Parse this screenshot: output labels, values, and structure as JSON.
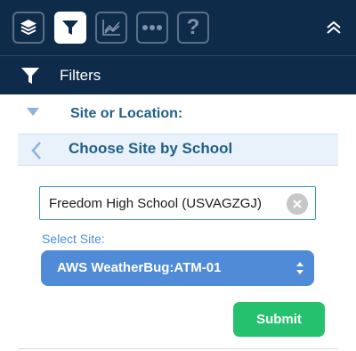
{
  "toolbar": {
    "buttons": [
      {
        "name": "layers-icon",
        "active": false
      },
      {
        "name": "filter-icon",
        "active": true
      },
      {
        "name": "chart-icon",
        "active": false
      },
      {
        "name": "more-icon",
        "active": false
      },
      {
        "name": "help-icon",
        "active": false,
        "glyph": "?"
      }
    ],
    "collapse_icon": "chevron-up-double-icon"
  },
  "filters": {
    "title": "Filters"
  },
  "site_section": {
    "label": "Site or Location:"
  },
  "choose": {
    "title": "Choose Site by School"
  },
  "school_search": {
    "value": "Freedom High School (USVAGZGJ)"
  },
  "select_site": {
    "label": "Select Site:",
    "selected": "AWS WeatherBug:ATM-01"
  },
  "submit": {
    "label": "Submit"
  },
  "colors": {
    "header_bg": "#0f2b4a",
    "accent_blue": "#4f8bd6",
    "label_blue": "#1f5f8b",
    "submit_green": "#25c16f"
  }
}
